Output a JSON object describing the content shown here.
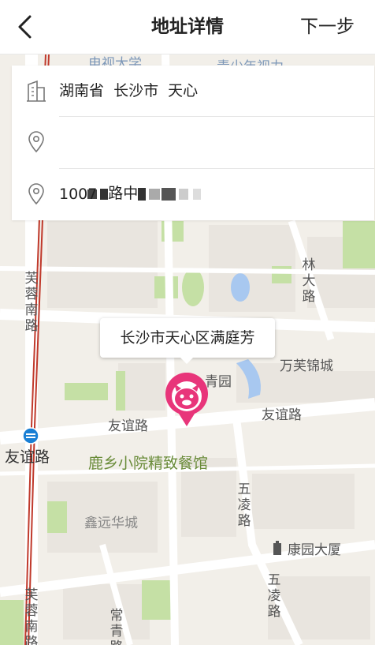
{
  "nav": {
    "title": "地址详情",
    "next_label": "下一步"
  },
  "address": {
    "region": "湖南省  长沙市  天心",
    "street": "路中",
    "detail": "1007"
  },
  "tooltip": {
    "text": "长沙市天心区满庭芳"
  },
  "map_labels": {
    "top_partial_1": "电视大学",
    "top_partial_2": "青少年视力",
    "qingyuan": "青园",
    "wanfu": "万芙锦城",
    "youyi_road_1": "友谊路",
    "youyi_road_2": "友谊路",
    "youyi_station": "友谊路",
    "restaurant": "鹿乡小院精致餐馆",
    "xinyuan": "鑫远华城",
    "kangyuan": "康园大厦",
    "furong_south_1": "芙蓉南路",
    "furong_south_2": "芙蓉南路",
    "linda": "林大路",
    "wuling_1": "五凌路",
    "wuling_2": "五凌路",
    "changqing": "常青路"
  },
  "colors": {
    "pin": "#e8357a",
    "route": "#c0392b",
    "map_bg": "#f2efe9",
    "green": "#c5e0a5",
    "water": "#a8c8f0"
  },
  "icons": [
    "back-chevron-icon",
    "building-icon",
    "location-pin-icon",
    "map-marker-icon",
    "metro-station-icon",
    "office-building-icon"
  ]
}
